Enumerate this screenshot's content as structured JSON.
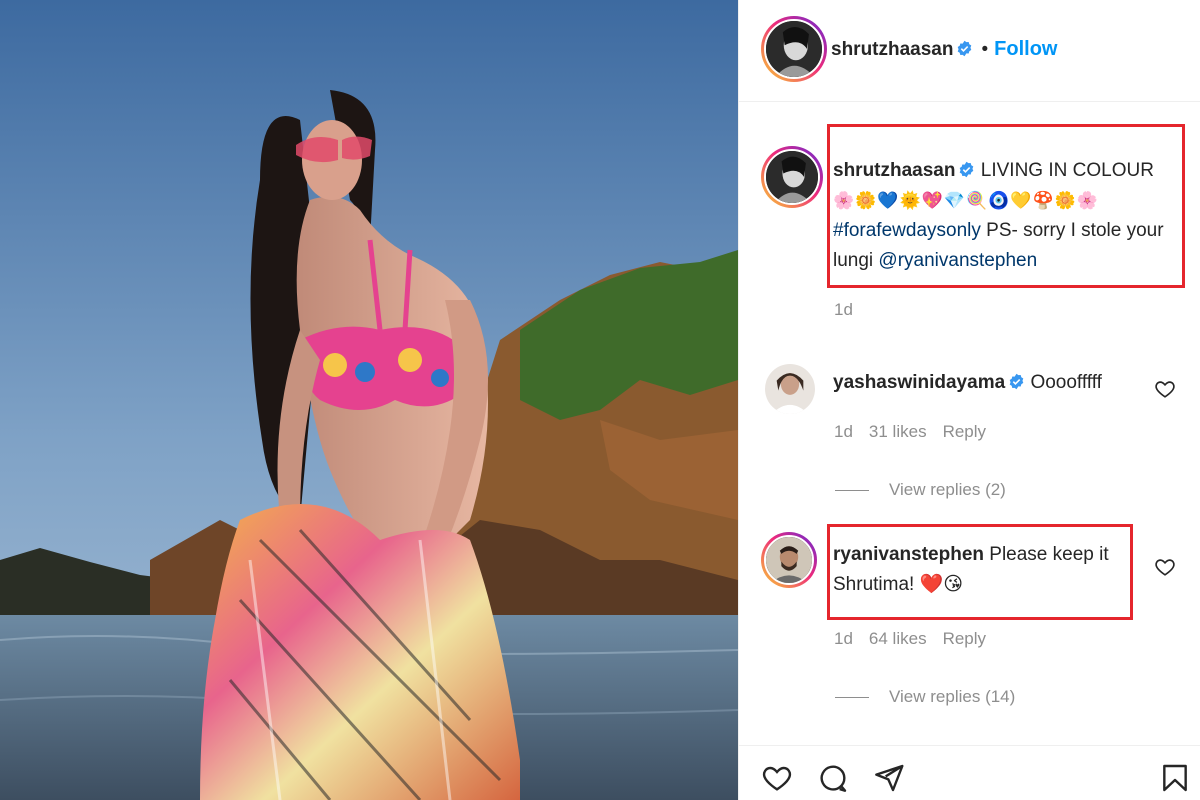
{
  "post": {
    "author": {
      "username": "shrutzhaasan",
      "verified": true,
      "follow_label": "Follow",
      "separator": "•"
    },
    "caption": {
      "username": "shrutzhaasan",
      "text_line1": "LIVING IN COLOUR",
      "emoji_line": "🌸🌼💙🌞💖💎🍭🧿💛🍄🌼🌸",
      "hashtag": "#forafewdaysonly",
      "text_rest": " PS- sorry I stole your lungi ",
      "mention": "@ryanivanstephen",
      "age": "1d"
    },
    "comments": [
      {
        "username": "yashaswinidayama",
        "verified": true,
        "text": "Oooofffff",
        "age": "1d",
        "likes": "31 likes",
        "reply_label": "Reply",
        "view_replies": "View replies (2)"
      },
      {
        "username": "ryanivanstephen",
        "verified": false,
        "text": "Please keep it Shrutima! ❤️😘",
        "age": "1d",
        "likes": "64 likes",
        "reply_label": "Reply",
        "view_replies": "View replies (14)"
      }
    ],
    "highlight_color": "#e5262d",
    "link_color": "#0095f6",
    "icons": {
      "like": "heart-icon",
      "comment": "comment-icon",
      "share": "share-icon",
      "save": "bookmark-icon",
      "verified": "verified-badge-icon"
    }
  }
}
